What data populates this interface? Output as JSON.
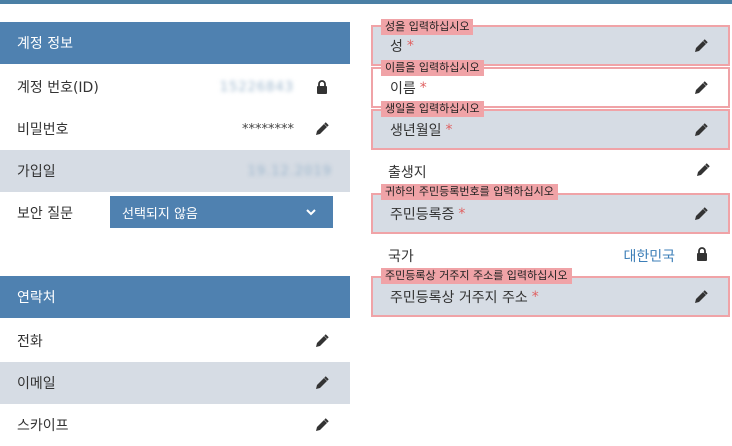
{
  "account": {
    "header": "계정 정보",
    "rows": [
      {
        "label": "계정 번호(ID)",
        "value": "15226843",
        "icon": "lock-icon"
      },
      {
        "label": "비밀번호",
        "value": "********",
        "icon": "pencil-icon"
      },
      {
        "label": "가입일",
        "value": "19.12.2019",
        "icon": ""
      },
      {
        "label": "보안 질문",
        "select_value": "선택되지 않음",
        "icon": "chevron-down-icon"
      }
    ]
  },
  "contact": {
    "header": "연락처",
    "rows": [
      {
        "label": "전화",
        "icon": "pencil-icon"
      },
      {
        "label": "이메일",
        "icon": "pencil-icon"
      },
      {
        "label": "스카이프",
        "icon": "pencil-icon"
      }
    ]
  },
  "personal": {
    "fields": [
      {
        "label": "성",
        "required": "*",
        "error": "성을 입력하십시오"
      },
      {
        "label": "이름",
        "required": "*",
        "error": "이름을 입력하십시오"
      },
      {
        "label": "생년월일",
        "required": "*",
        "error": "생일을 입력하십시오"
      },
      {
        "label": "출생지"
      },
      {
        "label": "주민등록증",
        "required": "*",
        "error": "귀하의 주민등록번호를 입력하십시오"
      },
      {
        "label": "국가",
        "value": "대한민국"
      },
      {
        "label": "주민등록상 거주지 주소",
        "required": "*",
        "error": "주민등록상 거주지 주소를 입력하십시오"
      }
    ]
  },
  "colors": {
    "header_bg": "#4f81b0",
    "shade_bg": "#d6dce4",
    "error_border": "#f0a3a7",
    "link_blue": "#3d7fb8",
    "required_red": "#e06060"
  }
}
